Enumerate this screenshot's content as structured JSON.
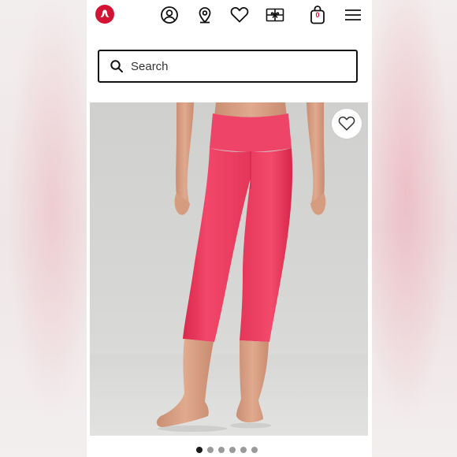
{
  "brand": {
    "name": "lululemon",
    "accent": "#d31334"
  },
  "header": {
    "icons": [
      "lululemon-logo-icon",
      "account-icon",
      "store-locator-icon",
      "wishlist-icon",
      "gift-card-icon",
      "shopping-bag-icon",
      "menu-icon"
    ],
    "cart_count": "0"
  },
  "search": {
    "placeholder": "Search"
  },
  "product": {
    "color": "#ee3a5e",
    "favorite_icon": "heart-outline-icon"
  },
  "carousel": {
    "total": 6,
    "active": 1
  }
}
